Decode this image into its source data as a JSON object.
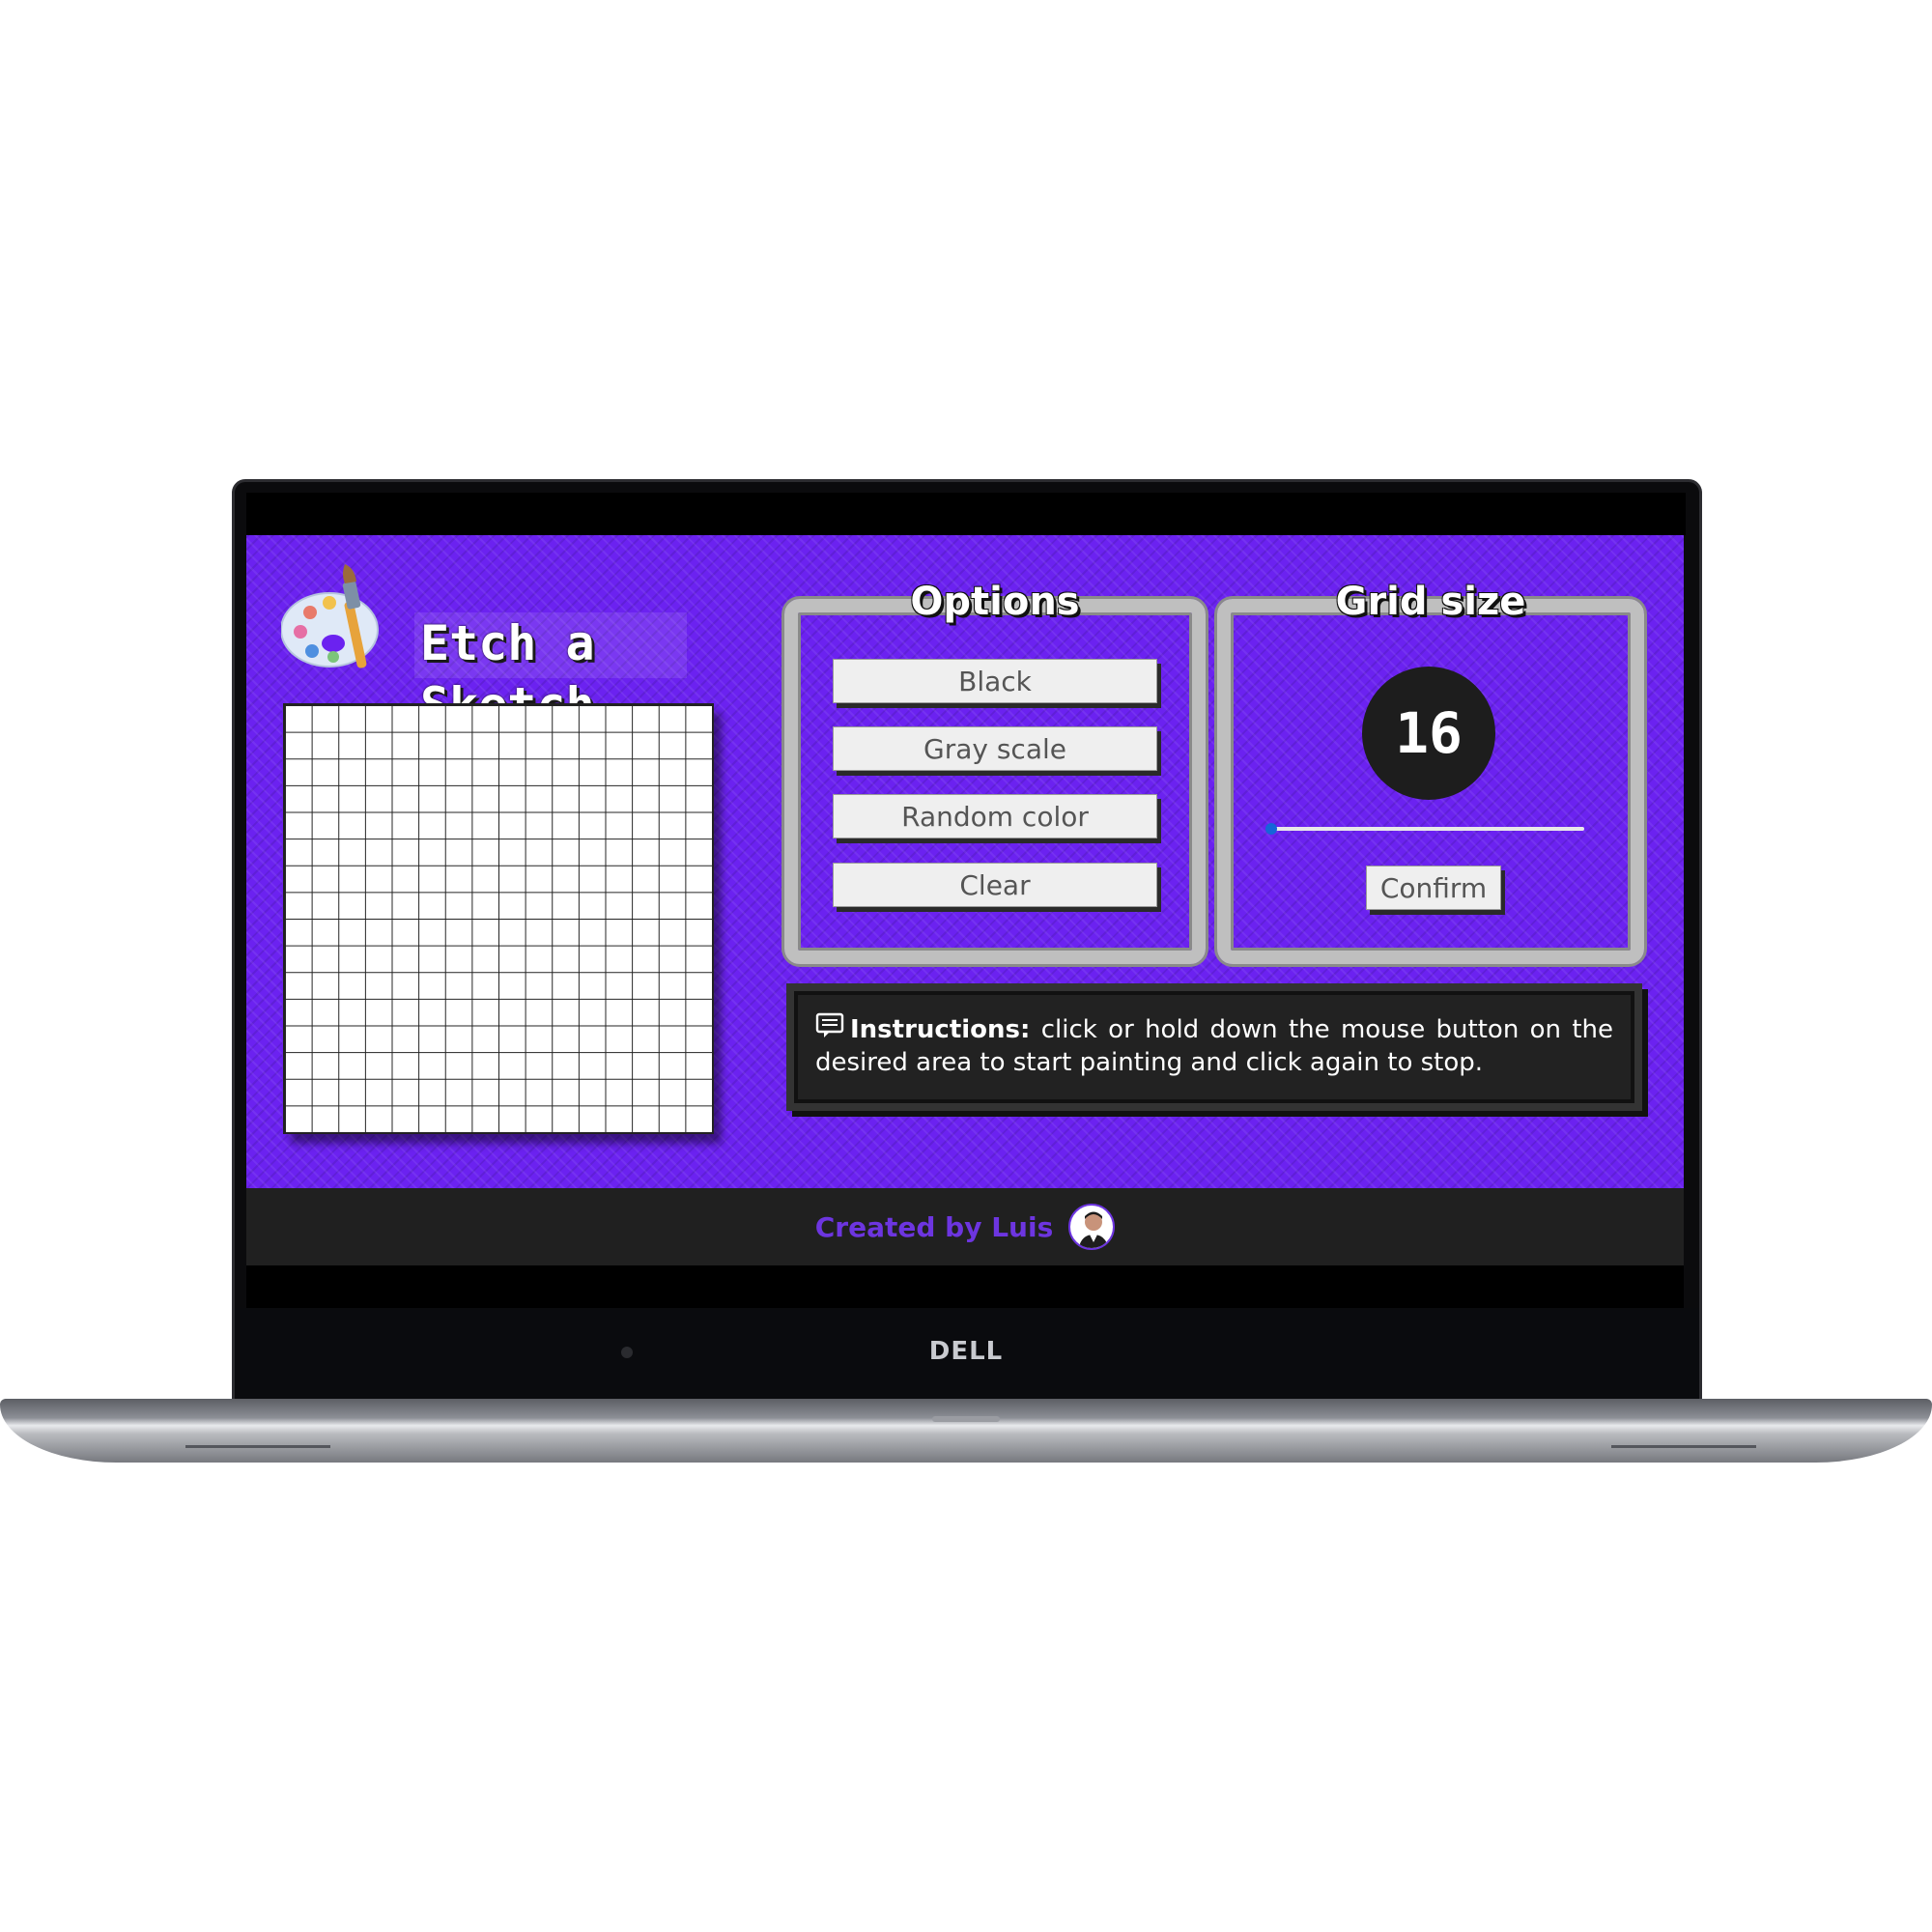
{
  "app": {
    "title": "Etch a Sketch"
  },
  "device": {
    "brand": "DELL"
  },
  "canvas": {
    "grid_size": 16
  },
  "options": {
    "heading": "Options",
    "buttons": [
      "Black",
      "Gray scale",
      "Random color",
      "Clear"
    ]
  },
  "grid_size_panel": {
    "heading": "Grid size",
    "value": "16",
    "slider_level": 0,
    "confirm_label": "Confirm"
  },
  "instructions": {
    "label": "Instructions:",
    "text": " click or hold down the mouse button on the desired area to start painting and click again to stop."
  },
  "footer": {
    "text": "Created by Luis"
  },
  "colors": {
    "background": "#6b22f0",
    "accent": "#6d35e0",
    "panel_border": "#bfbfbf",
    "dark": "#222222"
  },
  "icons": [
    "palette-icon",
    "instructions-icon",
    "avatar"
  ]
}
